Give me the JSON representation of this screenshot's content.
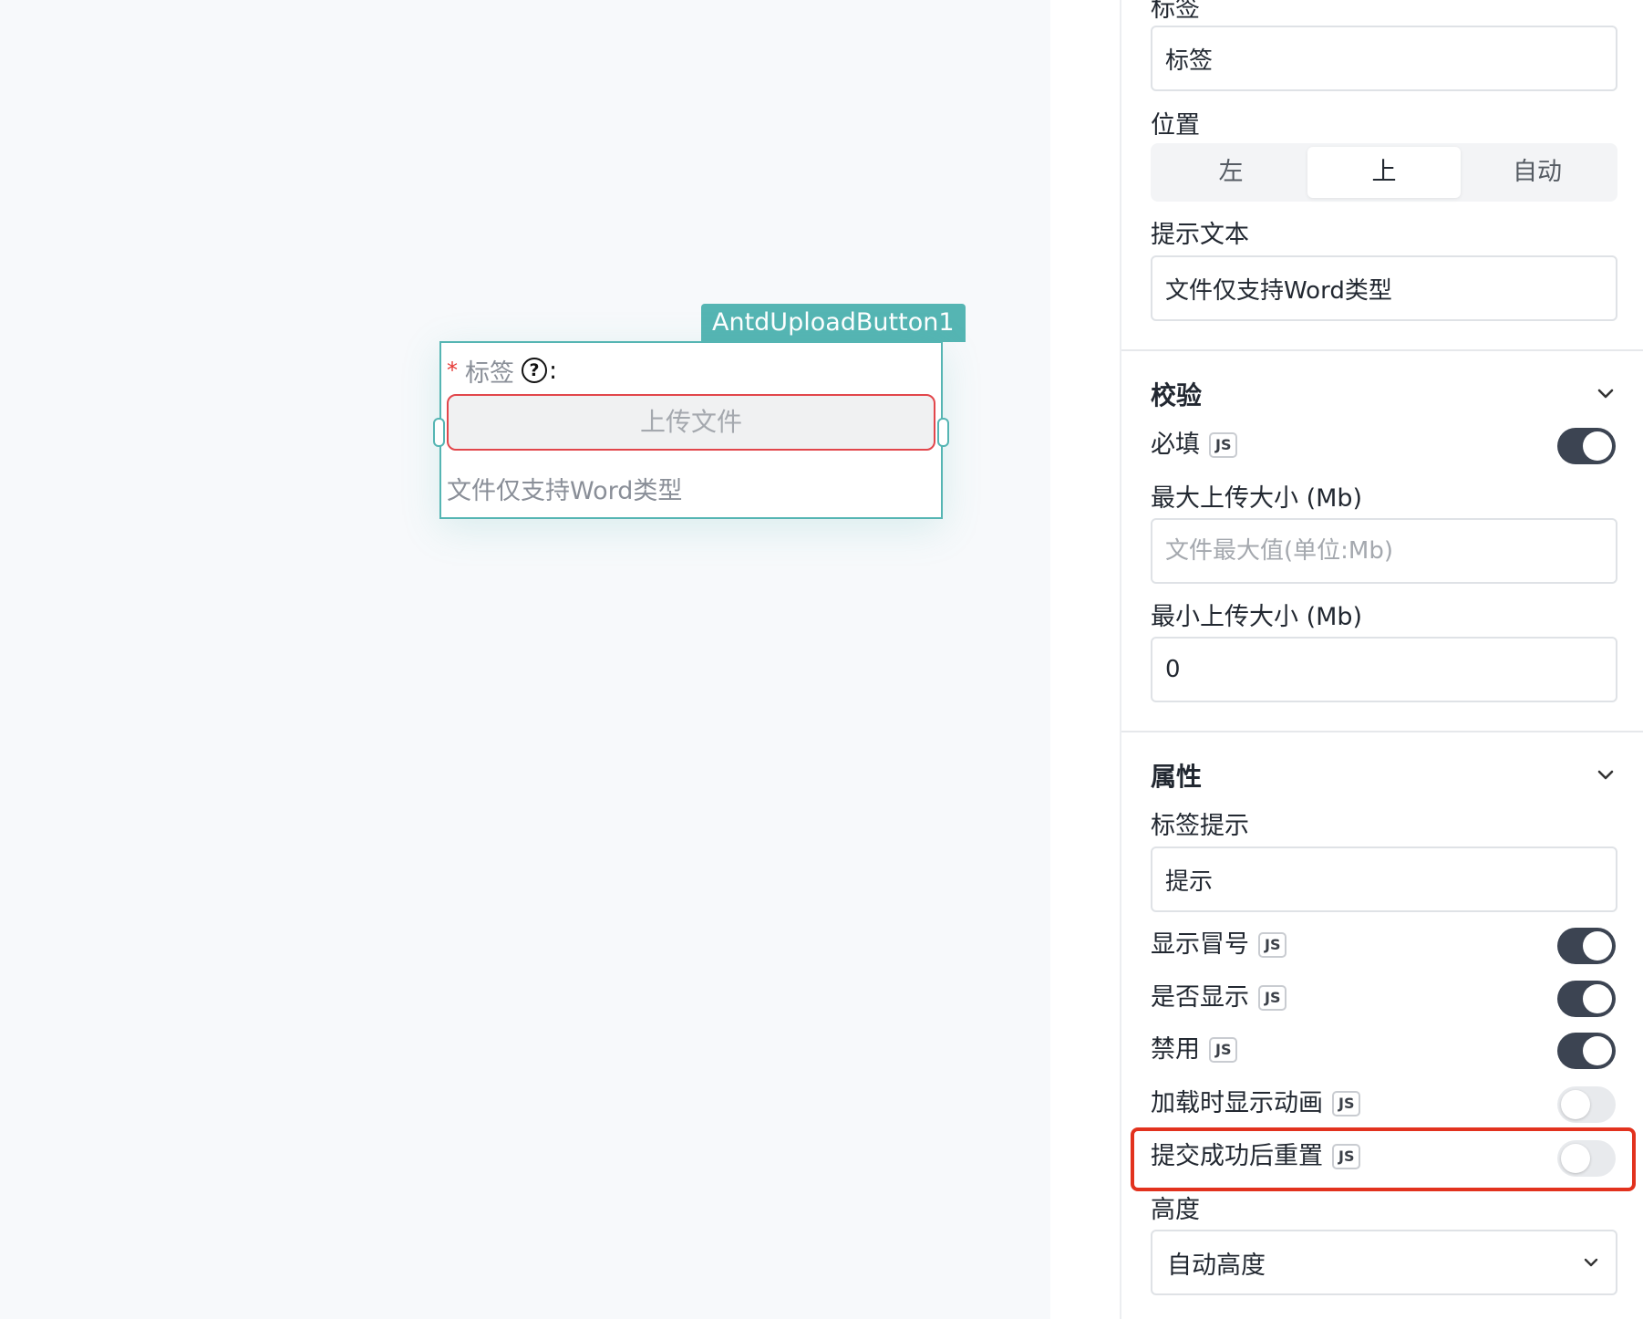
{
  "canvas": {
    "component_tag": "AntdUploadButton1",
    "component": {
      "required_star": "*",
      "label": "标签",
      "help_icon": "?",
      "colon": ":",
      "upload_button_label": "上传文件",
      "hint": "文件仅支持Word类型"
    }
  },
  "panel": {
    "label_field": {
      "label": "标签",
      "value": "标签"
    },
    "position": {
      "label": "位置",
      "options": [
        "左",
        "上",
        "自动"
      ],
      "selected": "上"
    },
    "hint_text": {
      "label": "提示文本",
      "value": "文件仅支持Word类型"
    },
    "validation": {
      "title": "校验",
      "required": {
        "label": "必填",
        "badge": "JS",
        "on": true
      },
      "max_size": {
        "label": "最大上传大小 (Mb)",
        "placeholder": "文件最大值(单位:Mb)",
        "value": ""
      },
      "min_size": {
        "label": "最小上传大小 (Mb)",
        "value": "0"
      }
    },
    "properties": {
      "title": "属性",
      "label_tooltip": {
        "label": "标签提示",
        "value": "提示"
      },
      "show_colon": {
        "label": "显示冒号",
        "badge": "JS",
        "on": true
      },
      "visible": {
        "label": "是否显示",
        "badge": "JS",
        "on": true
      },
      "disabled": {
        "label": "禁用",
        "badge": "JS",
        "on": true
      },
      "loading_animation": {
        "label": "加载时显示动画",
        "badge": "JS",
        "on": false
      },
      "reset_after_submit": {
        "label": "提交成功后重置",
        "badge": "JS",
        "on": false
      },
      "height": {
        "label": "高度",
        "value": "自动高度"
      }
    }
  },
  "colors": {
    "accent_teal": "#55b5b3",
    "toggle_on": "#3c4452",
    "highlight_red": "#e2321e",
    "error_border": "#e2464b"
  }
}
